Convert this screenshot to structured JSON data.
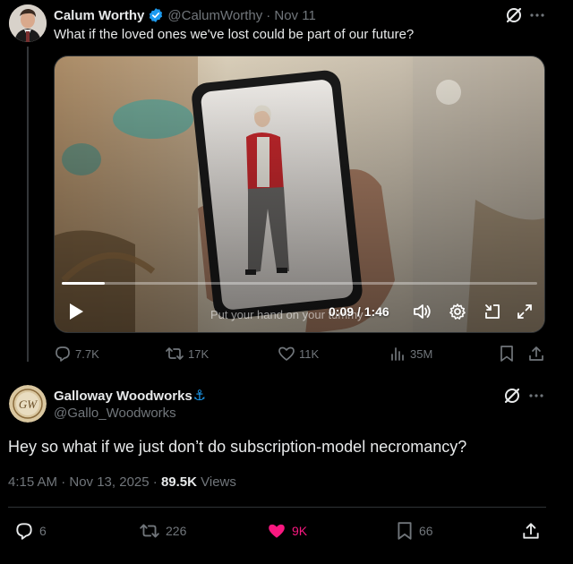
{
  "tweet1": {
    "author_name": "Calum Worthy",
    "handle": "@CalumWorthy",
    "time": "· Nov 11",
    "text": "What if the loved ones we've lost could be part of our future?",
    "video": {
      "caption": "Put your hand on your tummy",
      "time_display": "0:09 / 1:46",
      "progress": 0.09
    },
    "stats": {
      "replies": "7.7K",
      "reposts": "17K",
      "likes": "11K",
      "views": "35M"
    }
  },
  "tweet2": {
    "author_name": "Galloway Woodworks",
    "anchor_emoji": "⚓",
    "handle": "@Gallo_Woodworks",
    "text": "Hey so what if we just don’t do subscription-model necromancy?",
    "meta": {
      "time": "4:15 AM · Nov 13, 2025 · ",
      "views_count": "89.5K",
      "views_label": " Views"
    },
    "stats": {
      "replies": "6",
      "reposts": "226",
      "likes": "9K",
      "bookmarks": "66"
    },
    "like_color": "#f91880"
  },
  "colors": {
    "verified": "#1d9bf0",
    "secondary_text": "#71767b",
    "primary_text": "#e7e9ea"
  }
}
